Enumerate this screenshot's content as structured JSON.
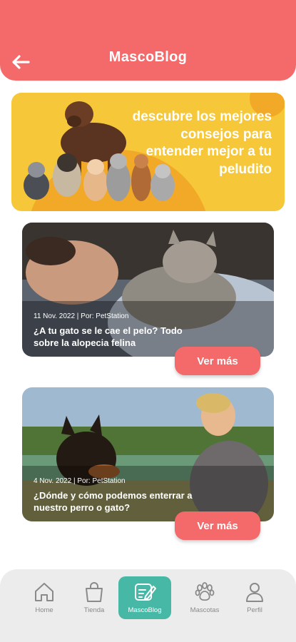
{
  "header": {
    "title": "MascoBlog",
    "back_icon": "arrow-left-icon",
    "color": "#f4696a"
  },
  "hero": {
    "text": "descubre los mejores consejos para entender mejor a tu peludito",
    "color": "#f6c739"
  },
  "posts": [
    {
      "meta": "11 Nov. 2022  |  Por: PetStation",
      "title": "¿A tu gato se le cae el pelo? Todo sobre la alopecia felina",
      "button": "Ver más"
    },
    {
      "meta": "4 Nov. 2022  |  Por: PetStation",
      "title": "¿Dónde y cómo podemos enterrar a nuestro perro o gato?",
      "button": "Ver más"
    }
  ],
  "nav": {
    "active_color": "#48b8a6",
    "items": [
      {
        "label": "Home",
        "icon": "home-icon"
      },
      {
        "label": "Tienda",
        "icon": "shopping-bag-icon"
      },
      {
        "label": "MascoBlog",
        "icon": "blog-edit-icon"
      },
      {
        "label": "Mascotas",
        "icon": "paw-icon"
      },
      {
        "label": "Perfil",
        "icon": "user-icon"
      }
    ]
  }
}
